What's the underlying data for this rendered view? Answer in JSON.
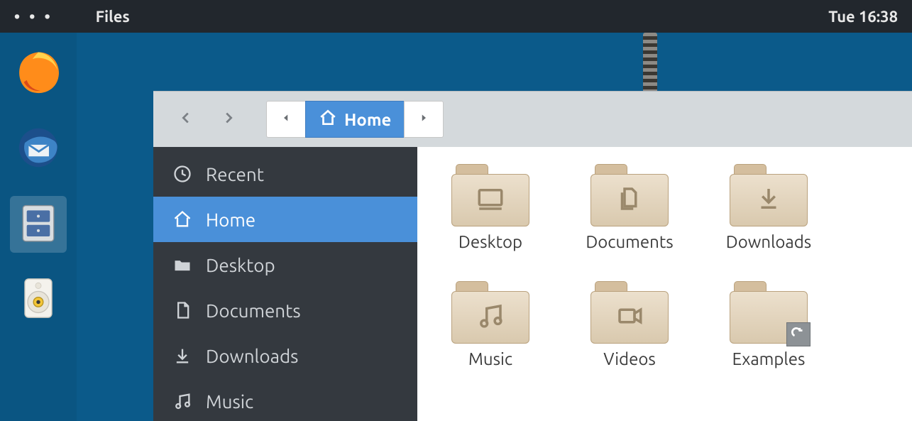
{
  "menubar": {
    "dots": "• • •",
    "app_label": "Files",
    "clock": "Tue 16:38"
  },
  "dock": {
    "items": [
      {
        "name": "firefox"
      },
      {
        "name": "thunderbird"
      },
      {
        "name": "files",
        "active": true
      },
      {
        "name": "rhythmbox"
      }
    ]
  },
  "path": {
    "current_label": "Home"
  },
  "sidebar": {
    "items": [
      {
        "icon": "clock",
        "label": "Recent"
      },
      {
        "icon": "home",
        "label": "Home",
        "selected": true
      },
      {
        "icon": "folder",
        "label": "Desktop"
      },
      {
        "icon": "document",
        "label": "Documents"
      },
      {
        "icon": "download",
        "label": "Downloads"
      },
      {
        "icon": "music",
        "label": "Music"
      }
    ]
  },
  "folders": [
    {
      "label": "Desktop",
      "glyph": "desktop"
    },
    {
      "label": "Documents",
      "glyph": "documents"
    },
    {
      "label": "Downloads",
      "glyph": "download"
    },
    {
      "label": "Music",
      "glyph": "music"
    },
    {
      "label": "Videos",
      "glyph": "video"
    },
    {
      "label": "Examples",
      "glyph": "folder",
      "link_badge": true
    }
  ]
}
